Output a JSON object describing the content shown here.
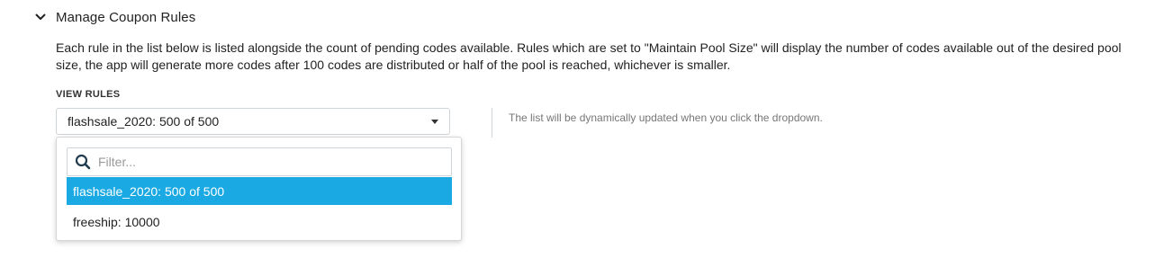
{
  "section": {
    "title": "Manage Coupon Rules",
    "description": "Each rule in the list below is listed alongside the count of pending codes available. Rules which are set to \"Maintain Pool Size\" will display the number of codes available out of the desired pool size, the app will generate more codes after 100 codes are distributed or half of the pool is reached, whichever is smaller."
  },
  "view_rules": {
    "label": "VIEW RULES",
    "selected_value": "flashsale_2020: 500 of 500",
    "hint": "The list will be dynamically updated when you click the dropdown."
  },
  "dropdown": {
    "filter_placeholder": "Filter...",
    "filter_value": "",
    "options": [
      {
        "label": "flashsale_2020: 500 of 500",
        "selected": true
      },
      {
        "label": "freeship: 10000",
        "selected": false
      }
    ]
  },
  "colors": {
    "selected_bg": "#1aa9e2",
    "icon": "#1f3b4d"
  },
  "icons": {
    "collapse": "chevron-down-icon",
    "search": "search-icon",
    "select_caret": "caret-down-icon"
  }
}
